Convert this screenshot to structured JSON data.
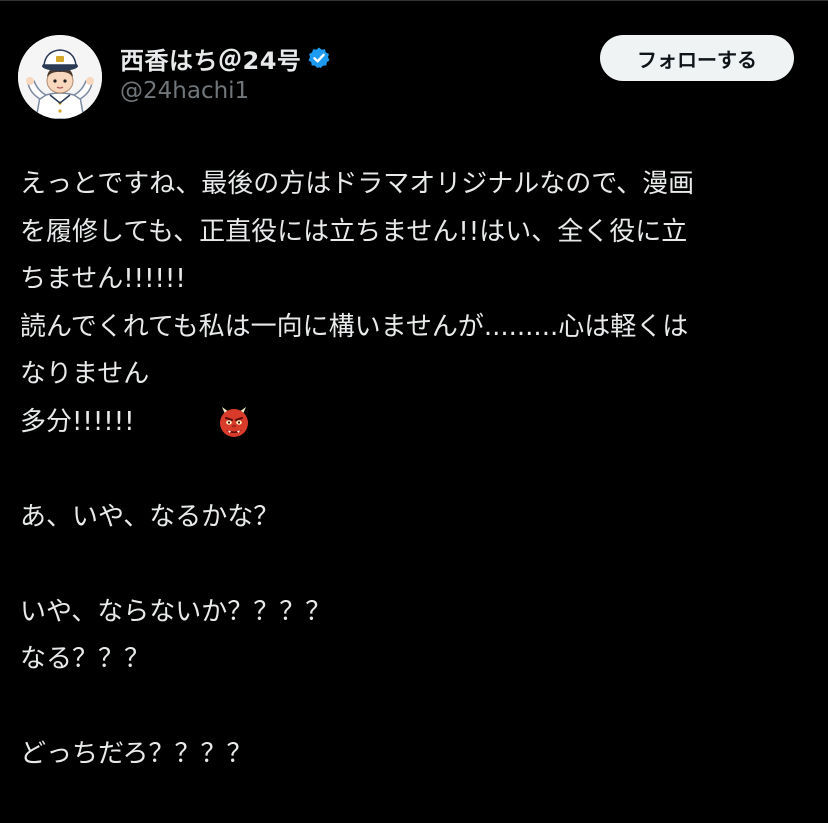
{
  "author": {
    "display_name": "西香はち＠24号",
    "handle": "@24hachi1",
    "verified": true,
    "avatar_icon": "sailor-chef-avatar-icon",
    "verified_color": "#1d9bf0"
  },
  "follow_button": {
    "label": "フォローする"
  },
  "tweet": {
    "lines": [
      "えっとですね、最後の方はドラマオリジナルなので、漫画",
      "を履修しても、正直役には立ちません!!はい、全く役に立",
      "ちません!!!!!!",
      "読んでくれても私は一向に構いませんが.........心は軽くは",
      "なりません",
      "多分!!!!!!",
      "",
      "あ、いや、なるかな？",
      "",
      "いや、ならないか？？？？",
      "なる？？？",
      "",
      "どっちだろ？？？？"
    ],
    "emoji": "oni-face-emoji"
  },
  "colors": {
    "background": "#000000",
    "text": "#e7e9ea",
    "secondary_text": "#71767b",
    "button_bg": "#eff3f4",
    "button_text": "#0f1419"
  }
}
